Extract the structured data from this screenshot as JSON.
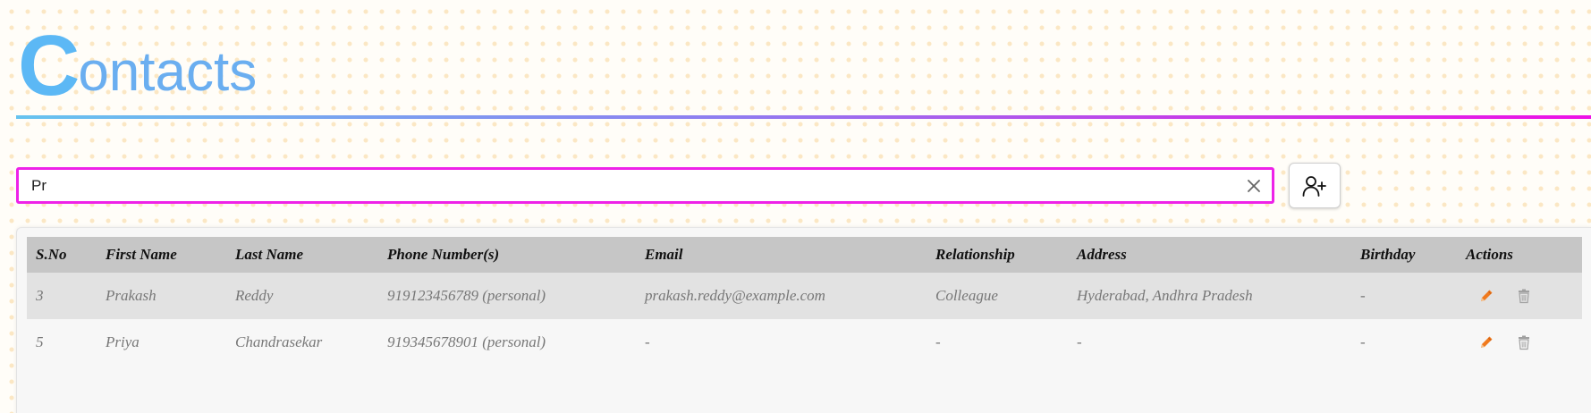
{
  "header": {
    "title_first_letter": "C",
    "title_rest": "ontacts"
  },
  "search": {
    "value": "Pr",
    "placeholder": ""
  },
  "colors": {
    "accent": "#ee22e8",
    "title": "#66b3f2",
    "edit_icon": "#f07a1e",
    "delete_icon": "#9a9a9a",
    "header_row": "#c6c6c6"
  },
  "icons": {
    "clear": "close-icon",
    "add_contact": "add-user-icon",
    "edit": "pencil-icon",
    "delete": "trash-icon"
  },
  "table": {
    "columns": [
      "S.No",
      "First Name",
      "Last Name",
      "Phone Number(s)",
      "Email",
      "Relationship",
      "Address",
      "Birthday",
      "Actions"
    ],
    "rows": [
      {
        "sno": "3",
        "first_name": "Prakash",
        "last_name": "Reddy",
        "phone": "919123456789 (personal)",
        "email": "prakash.reddy@example.com",
        "relationship": "Colleague",
        "address": "Hyderabad, Andhra Pradesh",
        "birthday": "-"
      },
      {
        "sno": "5",
        "first_name": "Priya",
        "last_name": "Chandrasekar",
        "phone": "919345678901 (personal)",
        "email": "-",
        "relationship": "-",
        "address": "-",
        "birthday": "-"
      }
    ]
  }
}
